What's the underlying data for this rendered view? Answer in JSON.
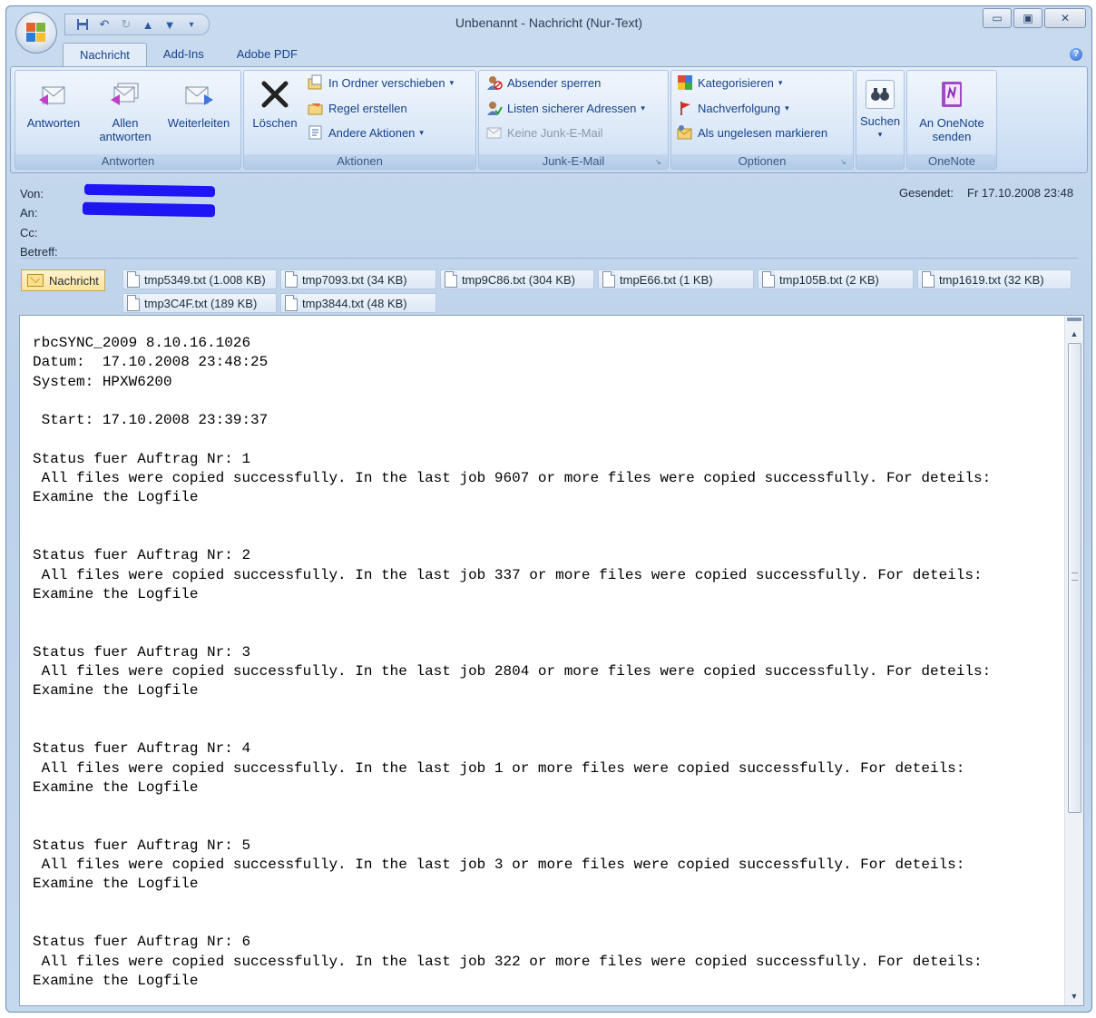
{
  "window": {
    "title": "Unbenannt - Nachricht (Nur-Text)",
    "controls": {
      "minimize": "▭",
      "maximize": "▣",
      "close": "✕"
    }
  },
  "qat": [
    "save-icon",
    "undo-icon",
    "redo-icon",
    "previous-item-icon",
    "next-item-icon",
    "customize-qat-icon"
  ],
  "tabs": [
    "Nachricht",
    "Add-Ins",
    "Adobe PDF"
  ],
  "ribbon": {
    "groups": {
      "antworten": {
        "label": "Antworten",
        "buttons": [
          "Antworten",
          "Allen antworten",
          "Weiterleiten"
        ]
      },
      "aktionen": {
        "label": "Aktionen",
        "delete": "Löschen",
        "items": [
          "In Ordner verschieben",
          "Regel erstellen",
          "Andere Aktionen"
        ]
      },
      "junk": {
        "label": "Junk-E-Mail",
        "items": [
          "Absender sperren",
          "Listen sicherer Adressen",
          "Keine Junk-E-Mail"
        ]
      },
      "optionen": {
        "label": "Optionen",
        "items": [
          "Kategorisieren",
          "Nachverfolgung",
          "Als ungelesen markieren"
        ]
      },
      "suchen": {
        "label": "",
        "button": "Suchen"
      },
      "onenote": {
        "label": "OneNote",
        "button": "An OneNote senden"
      }
    }
  },
  "header": {
    "from_label": "Von:",
    "to_label": "An:",
    "cc_label": "Cc:",
    "subject_label": "Betreff:",
    "sent_label": "Gesendet:",
    "sent_value": "Fr 17.10.2008 23:48"
  },
  "attachments": {
    "message_tab": "Nachricht",
    "files": [
      "tmp5349.txt (1.008 KB)",
      "tmp7093.txt (34 KB)",
      "tmp9C86.txt (304 KB)",
      "tmpE66.txt (1 KB)",
      "tmp105B.txt (2 KB)",
      "tmp1619.txt (32 KB)",
      "tmp3C4F.txt (189 KB)",
      "tmp3844.txt (48 KB)"
    ]
  },
  "body": {
    "text": "rbcSYNC_2009 8.10.16.1026\nDatum:  17.10.2008 23:48:25\nSystem: HPXW6200\n\n Start: 17.10.2008 23:39:37\n\nStatus fuer Auftrag Nr: 1\n All files were copied successfully. In the last job 9607 or more files were copied successfully. For deteils:\nExamine the Logfile\n\n\nStatus fuer Auftrag Nr: 2\n All files were copied successfully. In the last job 337 or more files were copied successfully. For deteils:\nExamine the Logfile\n\n\nStatus fuer Auftrag Nr: 3\n All files were copied successfully. In the last job 2804 or more files were copied successfully. For deteils:\nExamine the Logfile\n\n\nStatus fuer Auftrag Nr: 4\n All files were copied successfully. In the last job 1 or more files were copied successfully. For deteils:\nExamine the Logfile\n\n\nStatus fuer Auftrag Nr: 5\n All files were copied successfully. In the last job 3 or more files were copied successfully. For deteils:\nExamine the Logfile\n\n\nStatus fuer Auftrag Nr: 6\n All files were copied successfully. In the last job 322 or more files were copied successfully. For deteils:\nExamine the Logfile"
  }
}
